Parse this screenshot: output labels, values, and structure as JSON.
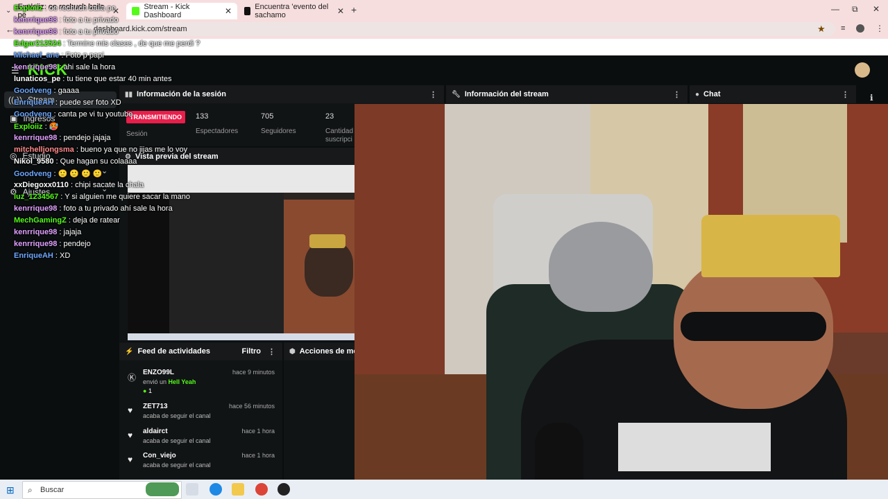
{
  "browser": {
    "tabs": [
      {
        "label": "Exploiiz: oe rechuch baila pe",
        "active": false
      },
      {
        "label": "Stream - Kick Dashboard",
        "active": true
      },
      {
        "label": "Encuentra 'evento del sachamo",
        "active": false
      }
    ],
    "url": "dashboard.kick.com/stream",
    "new_tab": "+",
    "window_controls": {
      "minimize": "—",
      "restore": "⧉",
      "close": "✕"
    }
  },
  "kick": {
    "logo": "KICK",
    "sidebar": [
      {
        "label": "Stream",
        "icon": "broadcast-icon"
      },
      {
        "label": "Ingresos",
        "icon": "money-icon"
      },
      {
        "label": "Estudio",
        "icon": "studio-icon"
      },
      {
        "label": "Ajustes",
        "icon": "gear-icon"
      }
    ],
    "session_panel": {
      "title": "Información de la sesión",
      "badge": "TRANSMITIENDO",
      "session_label": "Sesión",
      "stats": [
        {
          "value": "133",
          "label": "Espectadores"
        },
        {
          "value": "705",
          "label": "Seguidores"
        },
        {
          "value": "23",
          "label": "Cantidad suscripci"
        }
      ]
    },
    "stream_info_title": "Información del stream",
    "chat_title": "Chat",
    "preview_title": "Vista previa del stream",
    "feed": {
      "title": "Feed de actividades",
      "filter": "Filtro",
      "items": [
        {
          "name": "ENZO99L",
          "time": "hace 9 minutos",
          "sub": "envió un",
          "highlight": "Hell Yeah",
          "count": "1"
        },
        {
          "name": "ZET713",
          "time": "hace 56 minutos",
          "sub": "acaba de seguir el canal"
        },
        {
          "name": "aldairct",
          "time": "hace 1 hora",
          "sub": "acaba de seguir el canal"
        },
        {
          "name": "Con_viejo",
          "time": "hace 1 hora",
          "sub": "acaba de seguir el canal"
        }
      ]
    },
    "mod_actions_title": "Acciones de mode"
  },
  "chat_overlay": [
    {
      "user": "Exploiiz",
      "msg": "oe rechuch baila pe",
      "color": "#53fc18"
    },
    {
      "user": "kenrrique98",
      "msg": "foto a tu privado",
      "color": "#e0a0ff"
    },
    {
      "user": "kenrrique98",
      "msg": "foto a tu privado",
      "color": "#e0a0ff"
    },
    {
      "user": "Edgar212524",
      "msg": "Termine mis clases , de que me perdi ?",
      "color": "#53fc18"
    },
    {
      "user": "Michael_ane",
      "msg": "Foto p papi",
      "color": "#6ea8ff"
    },
    {
      "user": "kenrrique98",
      "msg": "ahi sale la hora",
      "color": "#e0a0ff"
    },
    {
      "user": "lunaticos_pe",
      "msg": "tu tiene que estar 40 min antes",
      "color": "#ffffff"
    },
    {
      "user": "Goodveng",
      "msg": "gaaaa",
      "color": "#6ea8ff"
    },
    {
      "user": "EnriqueAH",
      "msg": "puede ser foto XD",
      "color": "#6ea8ff"
    },
    {
      "user": "Goodveng",
      "msg": "canta pe vi tu youtube",
      "color": "#6ea8ff"
    },
    {
      "user": "Exploiiz",
      "msg": "🥵",
      "color": "#53fc18"
    },
    {
      "user": "kenrrique98",
      "msg": "pendejo jajaja",
      "color": "#e0a0ff"
    },
    {
      "user": "mitchelljongsma",
      "msg": "bueno ya que no jijas me lo voy",
      "color": "#ff8a8a"
    },
    {
      "user": "Nikol_9580",
      "msg": "Que hagan su colaaaa",
      "color": "#ffffff"
    },
    {
      "user": "Goodveng",
      "msg": "🙂 🙂 🙂 🙂",
      "color": "#6ea8ff"
    },
    {
      "user": "xxDiegoxx0110",
      "msg": "chipi sacate la chala",
      "color": "#ffffff"
    },
    {
      "user": "luz_1234567",
      "msg": "Y si alguien me quiere sacar la mano",
      "color": "#53fc18"
    },
    {
      "user": "kenrrique98",
      "msg": "foto a tu privado ahí sale la hora",
      "color": "#e0a0ff"
    },
    {
      "user": "MechGamingZ",
      "msg": "deja de ratear",
      "color": "#53fc18"
    },
    {
      "user": "kenrrique98",
      "msg": "jajaja",
      "color": "#e0a0ff"
    },
    {
      "user": "kenrrique98",
      "msg": "pendejo",
      "color": "#e0a0ff"
    },
    {
      "user": "EnriqueAH",
      "msg": "XD",
      "color": "#6ea8ff"
    }
  ],
  "taskbar": {
    "search_placeholder": "Buscar"
  },
  "colors": {
    "kick_green": "#53fc18",
    "live_badge": "#e91e4b"
  }
}
